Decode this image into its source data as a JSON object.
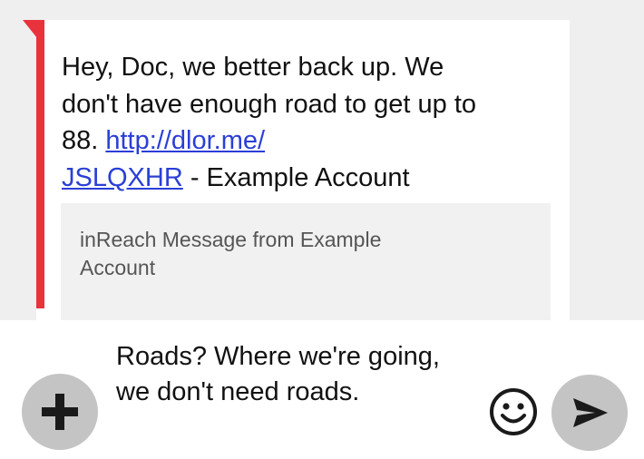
{
  "message": {
    "text_before_link": "Hey, Doc, we better back up. We don't have enough road to get up to 88. ",
    "link_line1": "http://dlor.me/",
    "link_line2": "JSLQXHR",
    "text_after_link": " - Example Account",
    "signature": "inReach Message from Example Account"
  },
  "compose": {
    "draft_text": "Roads? Where we're going, we don't need roads.",
    "add_icon": "plus-icon",
    "emoji_icon": "smiley-icon",
    "send_icon": "send-arrow-icon"
  },
  "colors": {
    "accent_bar": "#e8323c",
    "link": "#2a3fd6",
    "button_bg": "#c4c4c4",
    "thread_bg": "#efefef"
  }
}
